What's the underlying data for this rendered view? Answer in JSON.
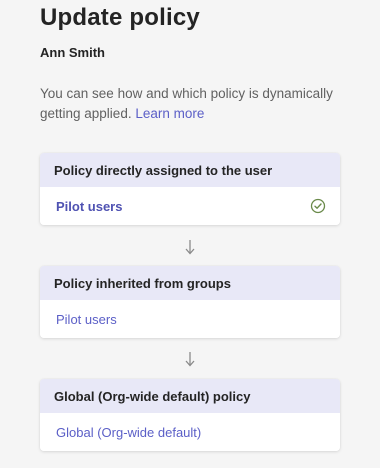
{
  "page": {
    "title": "Update policy",
    "user_name": "Ann Smith",
    "description": "You can see how and which policy is dynamically getting applied.",
    "learn_more": "Learn more"
  },
  "cards": [
    {
      "header": "Policy directly assigned to the user",
      "value": "Pilot users",
      "applied": true
    },
    {
      "header": "Policy inherited from groups",
      "value": "Pilot users",
      "applied": false
    },
    {
      "header": "Global (Org-wide default) policy",
      "value": "Global (Org-wide default)",
      "applied": false
    }
  ],
  "icons": {
    "applied": "check-circle-icon",
    "flow": "arrow-down-icon"
  },
  "colors": {
    "accent": "#5b5fc7",
    "header_bg": "#e8e8f7",
    "check": "#6a8a4a"
  }
}
